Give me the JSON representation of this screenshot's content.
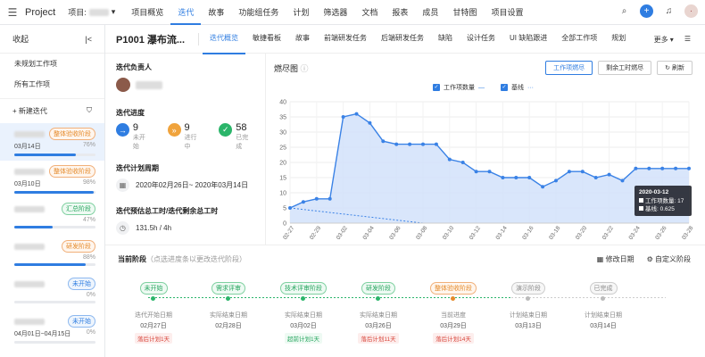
{
  "topbar": {
    "app": "Project",
    "project_label": "项目:",
    "nav": [
      "项目概览",
      "迭代",
      "故事",
      "功能组任务",
      "计划",
      "筛选器",
      "文档",
      "报表",
      "成员",
      "甘特图",
      "项目设置"
    ],
    "active": 1
  },
  "sidebar": {
    "collapse": "收起",
    "links": [
      "未规划工作项",
      "所有工作项"
    ],
    "new_label": "新建迭代",
    "items": [
      {
        "tag": "整体验收阶段",
        "tag_color": "orange",
        "date": "03月14日",
        "pct": "76%",
        "progress": 0.76,
        "selected": true
      },
      {
        "tag": "整体验收阶段",
        "tag_color": "orange",
        "date": "03月10日",
        "pct": "98%",
        "progress": 0.98
      },
      {
        "tag": "汇总阶段",
        "tag_color": "green",
        "date": "",
        "pct": "47%",
        "progress": 0.47
      },
      {
        "tag": "研发阶段",
        "tag_color": "orange",
        "date": "",
        "pct": "88%",
        "progress": 0.88
      },
      {
        "tag": "未开始",
        "tag_color": "blue",
        "date": "",
        "pct": "0%",
        "progress": 0
      },
      {
        "tag": "未开始",
        "tag_color": "blue",
        "date": "04月01日~04月15日",
        "pct": "0%",
        "progress": 0
      }
    ]
  },
  "main": {
    "title": "P1001 瀑布流...",
    "tabs": [
      "迭代概览",
      "敏捷看板",
      "故事",
      "前端研发任务",
      "后端研发任务",
      "缺陷",
      "设计任务",
      "UI 缺陷跟进",
      "全部工作项",
      "规划"
    ],
    "more": "更多",
    "owner_label": "迭代负责人",
    "progress_label": "迭代进度",
    "stats": [
      {
        "n": "9",
        "l": "未开始",
        "color": "#2f7de1",
        "icon": "→"
      },
      {
        "n": "9",
        "l": "进行中",
        "color": "#f0a33c",
        "icon": "»"
      },
      {
        "n": "58",
        "l": "已完成",
        "color": "#2bb56a",
        "icon": "✓"
      }
    ],
    "period_label": "迭代计划周期",
    "period": "2020年02月26日~ 2020年03月14日",
    "hours_label": "迭代预估总工时/迭代剩余总工时",
    "hours": "131.5h / 4h"
  },
  "chart_data": {
    "type": "line",
    "title": "燃尽图",
    "buttons": [
      "工作项燃尽",
      "剩余工时燃尽",
      "刷新"
    ],
    "series": [
      {
        "name": "工作项数量",
        "values": [
          5,
          7,
          8,
          8,
          35,
          36,
          33,
          27,
          26,
          26,
          26,
          26,
          21,
          20,
          17,
          17,
          15,
          15,
          15,
          12,
          14,
          17,
          17,
          15,
          16,
          14,
          18,
          18,
          18,
          18,
          18
        ]
      },
      {
        "name": "基线",
        "values": [
          5,
          4.5,
          4,
          3.5,
          3,
          2.5,
          2,
          1.5,
          1,
          0.5,
          0
        ]
      }
    ],
    "x": [
      "02-27",
      "02-29",
      "03-02",
      "03-04",
      "03-06",
      "03-08",
      "03-10",
      "03-12",
      "03-14",
      "03-16",
      "03-18",
      "03-20",
      "03-22",
      "03-24",
      "03-26",
      "03-28"
    ],
    "ylim": [
      0,
      40
    ],
    "yticks": [
      0,
      5,
      10,
      15,
      20,
      25,
      30,
      35,
      40
    ],
    "tooltip": {
      "date": "2020-03-12",
      "l1": "工作项数量: 17",
      "l2": "基线: 0.625"
    }
  },
  "phase": {
    "title": "当前阶段",
    "hint": "（点选进度条以更改迭代阶段）",
    "edit": "修改日期",
    "custom": "自定义阶段",
    "stages": [
      {
        "tag": "未开始",
        "color": "green",
        "label": "迭代开始日期",
        "date": "02月27日",
        "late": "落后计划1天",
        "late_color": "red"
      },
      {
        "tag": "需求评审",
        "color": "green",
        "label": "实际结束日期",
        "date": "02月28日",
        "late": "",
        "late_color": ""
      },
      {
        "tag": "技术评审阶段",
        "color": "green",
        "label": "实际结束日期",
        "date": "03月02日",
        "late": "超前计划1天",
        "late_color": "green"
      },
      {
        "tag": "研发阶段",
        "color": "green",
        "label": "实际结束日期",
        "date": "03月26日",
        "late": "落后计划11天",
        "late_color": "red"
      },
      {
        "tag": "整体验收阶段",
        "color": "orange",
        "label": "当前进度",
        "date": "03月29日",
        "late": "落后计划14天",
        "late_color": "red"
      },
      {
        "tag": "演示阶段",
        "color": "gray",
        "label": "计划结束日期",
        "date": "03月13日",
        "late": "",
        "late_color": ""
      },
      {
        "tag": "已完成",
        "color": "gray",
        "label": "计划结束日期",
        "date": "03月14日",
        "late": "",
        "late_color": ""
      }
    ]
  }
}
